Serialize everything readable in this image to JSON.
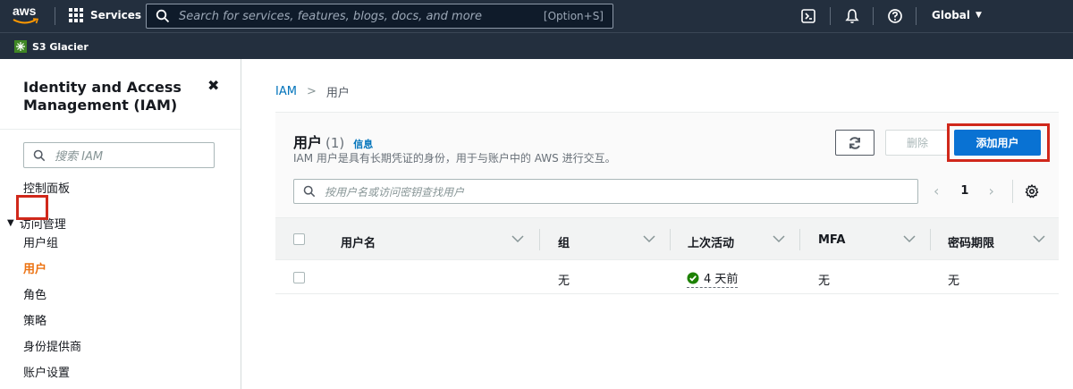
{
  "topnav": {
    "logo_text": "aws",
    "services_label": "Services",
    "search_placeholder": "Search for services, features, blogs, docs, and more",
    "search_shortcut": "[Option+S]",
    "region_label": "Global"
  },
  "subbar": {
    "favorite_service": "S3 Glacier"
  },
  "sidebar": {
    "title": "Identity and Access Management (IAM)",
    "search_placeholder": "搜索 IAM",
    "dashboard": "控制面板",
    "section_access": "访问管理",
    "items": [
      {
        "label": "用户组",
        "active": false
      },
      {
        "label": "用户",
        "active": true
      },
      {
        "label": "角色",
        "active": false
      },
      {
        "label": "策略",
        "active": false
      },
      {
        "label": "身份提供商",
        "active": false
      },
      {
        "label": "账户设置",
        "active": false
      }
    ]
  },
  "breadcrumb": {
    "root": "IAM",
    "current": "用户"
  },
  "users_panel": {
    "title": "用户",
    "count": "(1)",
    "info_link": "信息",
    "description": "IAM 用户是具有长期凭证的身份，用于与账户中的 AWS 进行交互。",
    "delete_label": "删除",
    "add_label": "添加用户",
    "search_placeholder": "按用户名或访问密钥查找用户",
    "current_page": "1"
  },
  "table": {
    "columns": [
      "用户名",
      "组",
      "上次活动",
      "MFA",
      "密码期限"
    ],
    "rows": [
      {
        "username": "",
        "groups": "无",
        "last_activity": "4 天前",
        "mfa": "无",
        "password_age": "无"
      }
    ]
  },
  "colors": {
    "nav_bg": "#232f3e",
    "primary_button": "#0972d3",
    "active_link": "#ec7211",
    "highlight_box": "#d0281b",
    "success_icon": "#1d8102"
  }
}
